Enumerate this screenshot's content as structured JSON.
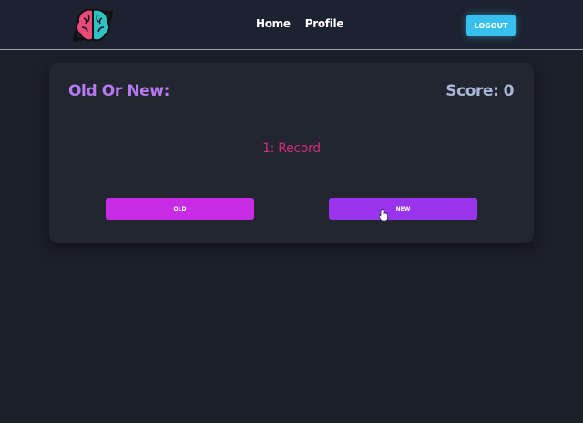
{
  "navbar": {
    "logo_icon": "brain-planet-logo-icon",
    "links": [
      {
        "label": "Home"
      },
      {
        "label": "Profile"
      }
    ],
    "logout_label": "LOGOUT",
    "accent_color": "#37c0ee"
  },
  "game": {
    "title": "Old Or New:",
    "score_label": "Score:",
    "score_value": "0",
    "word": "1: Record",
    "old_label": "OLD",
    "new_label": "NEW",
    "colors": {
      "title": "#b679f0",
      "word": "#d12a7d",
      "old_button": "#c72ce4",
      "new_button": "#9a34ec"
    }
  }
}
